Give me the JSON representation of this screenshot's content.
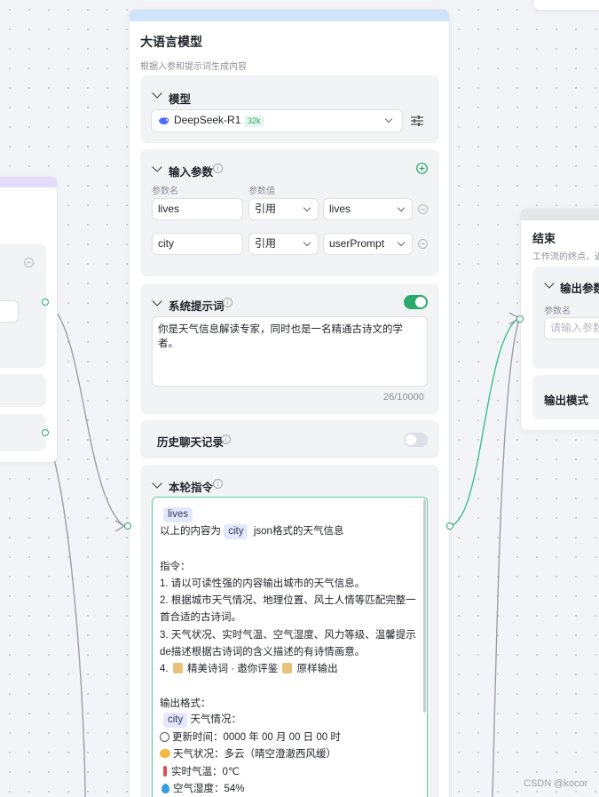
{
  "llm_node": {
    "title": "大语言模型",
    "subtitle": "根据入参和提示词生成内容",
    "model_section": {
      "label": "模型",
      "model_name": "DeepSeek-R1",
      "context_badge": "32k"
    },
    "input_params": {
      "label": "输入参数",
      "col_name": "参数名",
      "col_value": "参数值",
      "rows": [
        {
          "name": "lives",
          "type": "引用",
          "value": "lives"
        },
        {
          "name": "city",
          "type": "引用",
          "value": "userPrompt"
        }
      ]
    },
    "system_prompt": {
      "label": "系统提示词",
      "text": "你是天气信息解读专家，同时也是一名精通古诗文的学者。",
      "counter": "26/10000"
    },
    "history": {
      "label": "历史聊天记录"
    },
    "user_prompt": {
      "label": "本轮指令",
      "tag_lives": "lives",
      "line1_prefix": "以上的内容为",
      "tag_city": "city",
      "line1_suffix": "json格式的天气信息",
      "instr_heading": "指令：",
      "instr1": "1. 请以可读性强的内容输出城市的天气信息。",
      "instr2a": "2. 根据城市天气情况、地理位置、风土人情等匹配完整一",
      "instr2b": "首合适的古诗词。",
      "instr3a": "3. 天气状况、实时气温、空气湿度、风力等级、温馨提示",
      "instr3b": "de描述根据古诗词的含义描述的有诗情画意。",
      "instr4_prefix": "4.",
      "instr4_text": "精美诗词 · 邀你评鉴",
      "instr4_suffix": "原样输出",
      "output_heading": "输出格式：",
      "out_tag_city": "city",
      "out_weather": "天气情况：",
      "out_update": "更新时间：0000 年 00 月 00 日 00 时",
      "out_condition": "天气状况：多云（晴空澄澈西风缓）",
      "out_temp": "实时气温：0℃",
      "out_humidity": "空气湿度：54%"
    }
  },
  "end_node": {
    "title": "结束",
    "subtitle": "工作流的终点，返",
    "output_params_label": "输出参数",
    "col_name": "参数名",
    "input_placeholder": "请输入参数",
    "output_mode_label": "输出模式"
  },
  "watermark": "CSDN @kocor",
  "colors": {
    "accent_green": "#2aa96b",
    "tag_bg": "#e4e8fd",
    "header_band": "#cfe3fb"
  }
}
